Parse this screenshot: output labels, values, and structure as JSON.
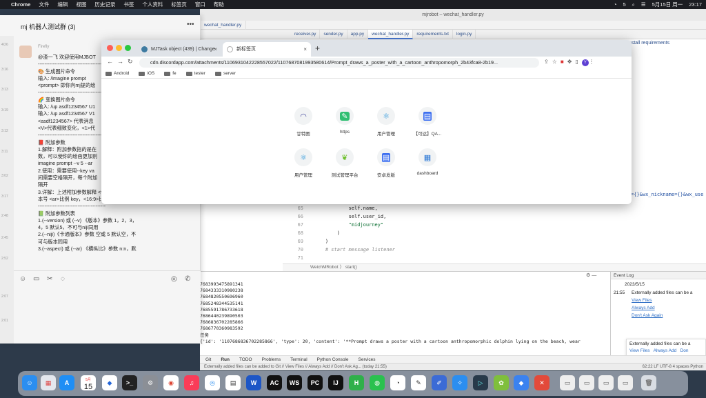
{
  "menubar": {
    "items": [
      "Chrome",
      "文件",
      "编辑",
      "视图",
      "历史记录",
      "书签",
      "个人资料",
      "标签页",
      "窗口",
      "帮助"
    ],
    "right": [
      "5",
      "5月15日 周一",
      "23:17"
    ]
  },
  "ide": {
    "title": "mjrobot – wechat_handler.py",
    "top_tab": "wechat_handler.py",
    "tabs": [
      "receiver.py",
      "sender.py",
      "app.py",
      "wechat_handler.py",
      "requirements.txt",
      "login.py"
    ],
    "install_hint": "Install requirements",
    "right_code": "={}&wx_nickname={}&wx_use",
    "breadcrumb": "WeichMRobot 〉 start()",
    "editor_lines": [
      {
        "n": "65",
        "code": "            self.name,"
      },
      {
        "n": "66",
        "code": "            self.user_id,"
      },
      {
        "n": "67",
        "code": "            \"midjourney\""
      },
      {
        "n": "68",
        "code": "        )"
      },
      {
        "n": "69",
        "code": "    )"
      },
      {
        "n": "70",
        "code": "    # start message listener"
      },
      {
        "n": "71",
        "code": ""
      }
    ],
    "run_output": [
      "7683993475891341",
      "7684333310980238",
      "7684820550696960",
      "7685248344535141",
      "7685591786733618",
      "7686440239890503",
      "7686836702285866",
      "7686770360983592",
      "任务",
      "{'id': '1107686836702285866', 'type': 20, 'content': '**Prompt draws a poster with a cartoon anthropomorphic dolphin lying on the beach, wear"
    ],
    "event_log": {
      "header": "Event Log",
      "date": "2023/5/15",
      "time": "21:55",
      "msg": "Externally added files can be a",
      "links": [
        "View Files",
        "Always Add",
        "Don't Ask Again"
      ]
    },
    "notification": {
      "msg": "Externally added files can be a",
      "links": [
        "View Files",
        "Always Add",
        "Don"
      ]
    },
    "bottom_tabs": [
      "Git",
      "Run",
      "TODO",
      "Problems",
      "Terminal",
      "Python Console",
      "Services"
    ],
    "status_left": "Externally added files can be added to Git // View Files // Always Add // Don't Ask Ag... (today 21:55)",
    "status_right": "62:22   LF   UTF-8   4 spaces   Python"
  },
  "chat": {
    "title": "mj 机器人测试群 (3)",
    "sender": "Firefly",
    "lines": [
      "@渣一飞 欢迎使用MJBOT",
      "-----------------------------------------",
      "🎨 生成图片命令",
      "输入: /imagine prompt",
      "<prompt> 即你向mj提的绘",
      "-----------------------------------------",
      "🌈 变换图片命令",
      "输入: /up asdf1234567 U1",
      "输入: /up asdf1234567 V1",
      "<asdf1234567> 代表消息",
      "<V>代表细致变化，<1>代",
      "-----------------------------------------",
      "📕 附加参数",
      "1.解释：附加参数指的是在",
      "数，可以使你的绘画更加别",
      "imagine prompt --v 5 --ar",
      "2.使用：需要使用--key va",
      "间需要空格隔开，每个附加",
      "隔开",
      "3.详解：上述附加参数解释 <v>版本 key <5>值",
      "本号 <ar>比例 key，<16:9>比例 value",
      "-----------------------------------------",
      "📗 附加参数列表",
      "1.(--version) 或 (--v) 《版本》参数 1，2，3，",
      "4，5 默认5，不可与niji同用",
      "2.(--niji)《卡通版本》参数 空或 5 默认空，不",
      "可与版本同用",
      "3.(--aspect) 或 (--ar) 《横纵比》参数 n:n，默"
    ],
    "strip_times": [
      "4/26",
      "3:16",
      "3:13",
      "3:19",
      "3:12",
      "3:11",
      "3:02",
      "3:17",
      "2:48",
      "2:45",
      "2:52",
      "2:07",
      "2:01"
    ]
  },
  "browser": {
    "tab1_title": "MJTask object (439) | Change",
    "tab2_title": "新标签页",
    "url": "cdn.discordapp.com/attachments/1106931042228557022/1107687081993580614/Prompt_draws_a_poster_with_a_cartoon_anthropomorph_2b43fca8-2b19...",
    "profile": "Y",
    "bookmarks": [
      "Android",
      "iOS",
      "fe",
      "tester",
      "server"
    ],
    "shortcuts": [
      {
        "label": "甘特图",
        "icon": "◠",
        "color": "#3b3f99"
      },
      {
        "label": "https",
        "icon": "✎",
        "color": "#2fbf71"
      },
      {
        "label": "用户管理",
        "icon": "⚛",
        "color": "#1c8fd9"
      },
      {
        "label": "【可达】QA...",
        "icon": "▤",
        "color": "#3d6ff0"
      },
      {
        "label": "用户管理",
        "icon": "⚛",
        "color": "#1c8fd9"
      },
      {
        "label": "测试管理平台",
        "icon": "❦",
        "color": "#6cbf2a"
      },
      {
        "label": "安卓发版",
        "icon": "▤",
        "color": "#3d6ff0"
      },
      {
        "label": "dashboard",
        "icon": "▦",
        "color": "#2d79d6"
      }
    ]
  },
  "dock": {
    "calendar_month": "5月",
    "calendar_day": "15",
    "apps": [
      "finder",
      "launchpad",
      "app-store",
      "calendar",
      "bluebird",
      "terminal",
      "system-prefs",
      "chrome",
      "music",
      "safari-like",
      "word",
      "ac",
      "webstorm",
      "pycharm",
      "intellij",
      "h-app",
      "wechat",
      "quicktime",
      "textedit",
      "pencil",
      "safari",
      "sublime",
      "photos",
      "share",
      "xcode",
      "trash"
    ]
  }
}
